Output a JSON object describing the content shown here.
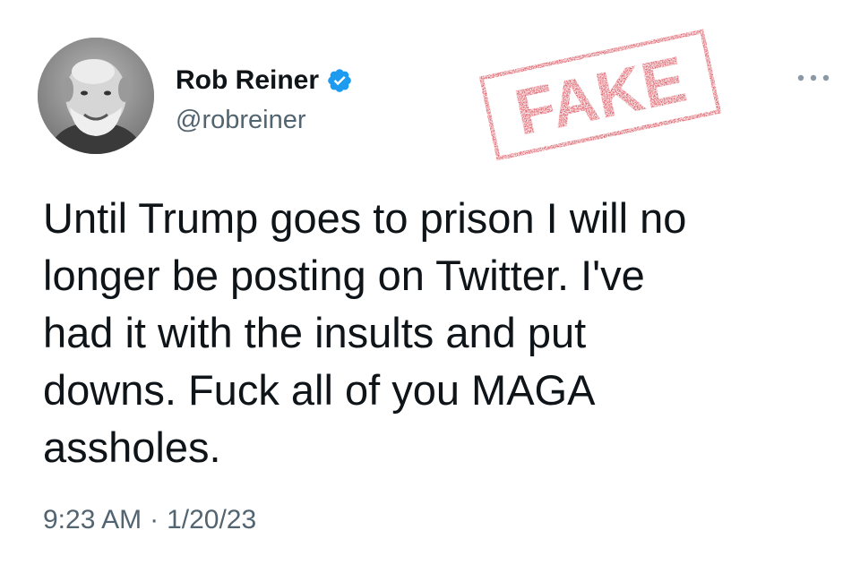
{
  "author": {
    "display_name": "Rob Reiner",
    "handle": "@robreiner",
    "verified": true,
    "verified_icon": "verified-badge-icon",
    "verified_color": "#1d9bf0"
  },
  "stamp": {
    "text": "FAKE",
    "color": "#d0202e"
  },
  "tweet": {
    "lines": [
      "Until Trump goes to prison I will no",
      "longer be posting on Twitter. I've",
      "had it with the insults and put",
      "downs. Fuck all of you MAGA",
      "assholes."
    ]
  },
  "meta": {
    "time": "9:23 AM",
    "separator": "·",
    "date": "1/20/23"
  },
  "icons": {
    "more": "more-options-icon"
  },
  "colors": {
    "text_primary": "#0f1419",
    "text_secondary": "#536471",
    "background": "#ffffff"
  }
}
